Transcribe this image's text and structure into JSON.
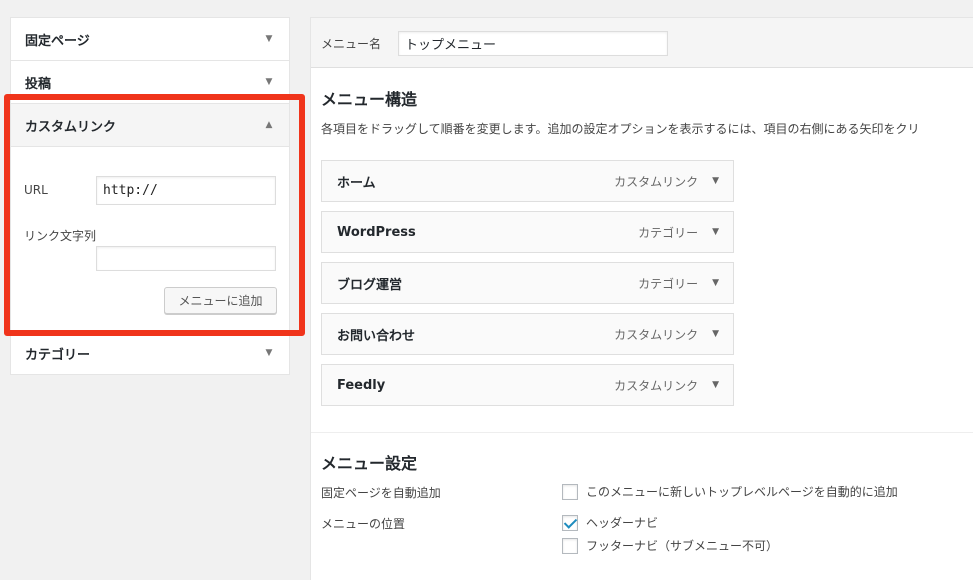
{
  "left_panel": {
    "sections": [
      {
        "title": "固定ページ"
      },
      {
        "title": "投稿"
      },
      {
        "title": "カスタムリンク"
      },
      {
        "title": "カテゴリー"
      }
    ],
    "custom_link": {
      "url_label": "URL",
      "url_value": "http://",
      "text_label": "リンク文字列",
      "text_value": "",
      "add_button": "メニューに追加"
    },
    "highlight_color": "#f0341b"
  },
  "menu_name": {
    "label": "メニュー名",
    "value": "トップメニュー"
  },
  "structure": {
    "title": "メニュー構造",
    "description": "各項目をドラッグして順番を変更します。追加の設定オプションを表示するには、項目の右側にある矢印をクリ",
    "items": [
      {
        "title": "ホーム",
        "type": "カスタムリンク"
      },
      {
        "title": "WordPress",
        "type": "カテゴリー"
      },
      {
        "title": "ブログ運営",
        "type": "カテゴリー"
      },
      {
        "title": "お問い合わせ",
        "type": "カスタムリンク"
      },
      {
        "title": "Feedly",
        "type": "カスタムリンク"
      }
    ]
  },
  "settings": {
    "title": "メニュー設定",
    "auto_add_label": "固定ページを自動追加",
    "auto_add_option": "このメニューに新しいトップレベルページを自動的に追加",
    "auto_add_checked": false,
    "location_label": "メニューの位置",
    "locations": [
      {
        "label": "ヘッダーナビ",
        "checked": true
      },
      {
        "label": "フッターナビ（サブメニュー不可）",
        "checked": false
      }
    ]
  },
  "icons": {
    "collapse_arrow": "triangle-down-icon",
    "expand_arrow": "triangle-up-icon",
    "check": "checkmark-icon"
  }
}
